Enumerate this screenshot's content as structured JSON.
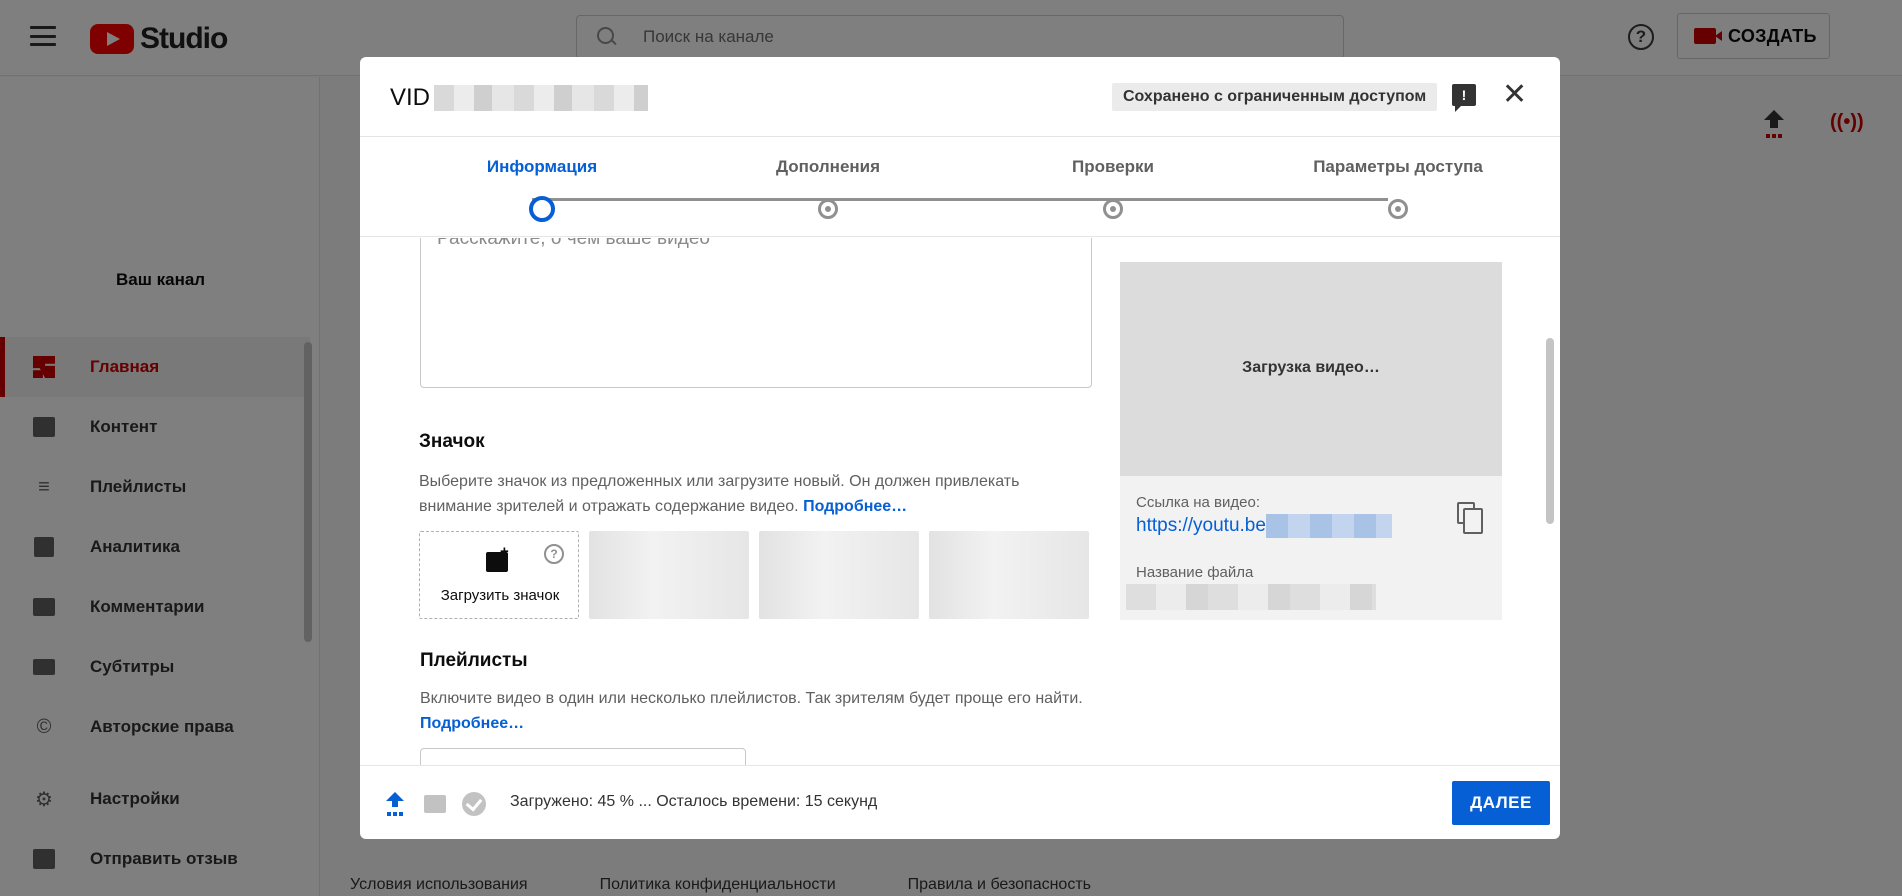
{
  "header": {
    "logo_text": "Studio",
    "search_placeholder": "Поиск на канале",
    "help_label": "?",
    "create_label": "СОЗДАТЬ"
  },
  "sidebar": {
    "channel_label": "Ваш канал",
    "items": [
      {
        "label": "Главная",
        "icon": "dashboard-icon",
        "active": true
      },
      {
        "label": "Контент",
        "icon": "video-library-icon"
      },
      {
        "label": "Плейлисты",
        "icon": "playlist-icon"
      },
      {
        "label": "Аналитика",
        "icon": "analytics-icon"
      },
      {
        "label": "Комментарии",
        "icon": "comments-icon"
      },
      {
        "label": "Субтитры",
        "icon": "subtitles-icon"
      },
      {
        "label": "Авторские права",
        "icon": "copyright-icon"
      },
      {
        "label": "Настройки",
        "icon": "settings-icon"
      },
      {
        "label": "Отправить отзыв",
        "icon": "feedback-icon"
      }
    ]
  },
  "footer_links": [
    "Условия использования",
    "Политика конфиденциальности",
    "Правила и безопасность"
  ],
  "dialog": {
    "title": "VID",
    "saved_status": "Сохранено с ограниченным доступом",
    "close_icon": "✕",
    "feedback_icon": "!",
    "steps": [
      {
        "label": "Информация",
        "active": true
      },
      {
        "label": "Дополнения"
      },
      {
        "label": "Проверки"
      },
      {
        "label": "Параметры доступа"
      }
    ],
    "description_placeholder": "Расскажите, о чем ваше видео",
    "thumbnail": {
      "title": "Значок",
      "text": "Выберите значок из предложенных или загрузите новый. Он должен привлекать внимание зрителей и отражать содержание видео.",
      "link": "Подробнее…",
      "upload_label": "Загрузить значок",
      "help": "?"
    },
    "playlists": {
      "title": "Плейлисты",
      "text": "Включите видео в один или несколько плейлистов. Так зрителям будет проще его найти.",
      "link": "Подробнее…"
    },
    "preview": {
      "loading": "Загрузка видео…",
      "link_label": "Ссылка на видео:",
      "link": "https://youtu.be/",
      "filename_label": "Название файла"
    },
    "footer": {
      "status": "Загружено: 45 % ... Осталось времени: 15 секунд",
      "progress_percent": 45,
      "next_label": "ДАЛЕЕ"
    }
  },
  "colors": {
    "accent": "#065fd4",
    "brand_red": "#cc0000",
    "overlay": "rgba(0,0,0,0.5)"
  }
}
